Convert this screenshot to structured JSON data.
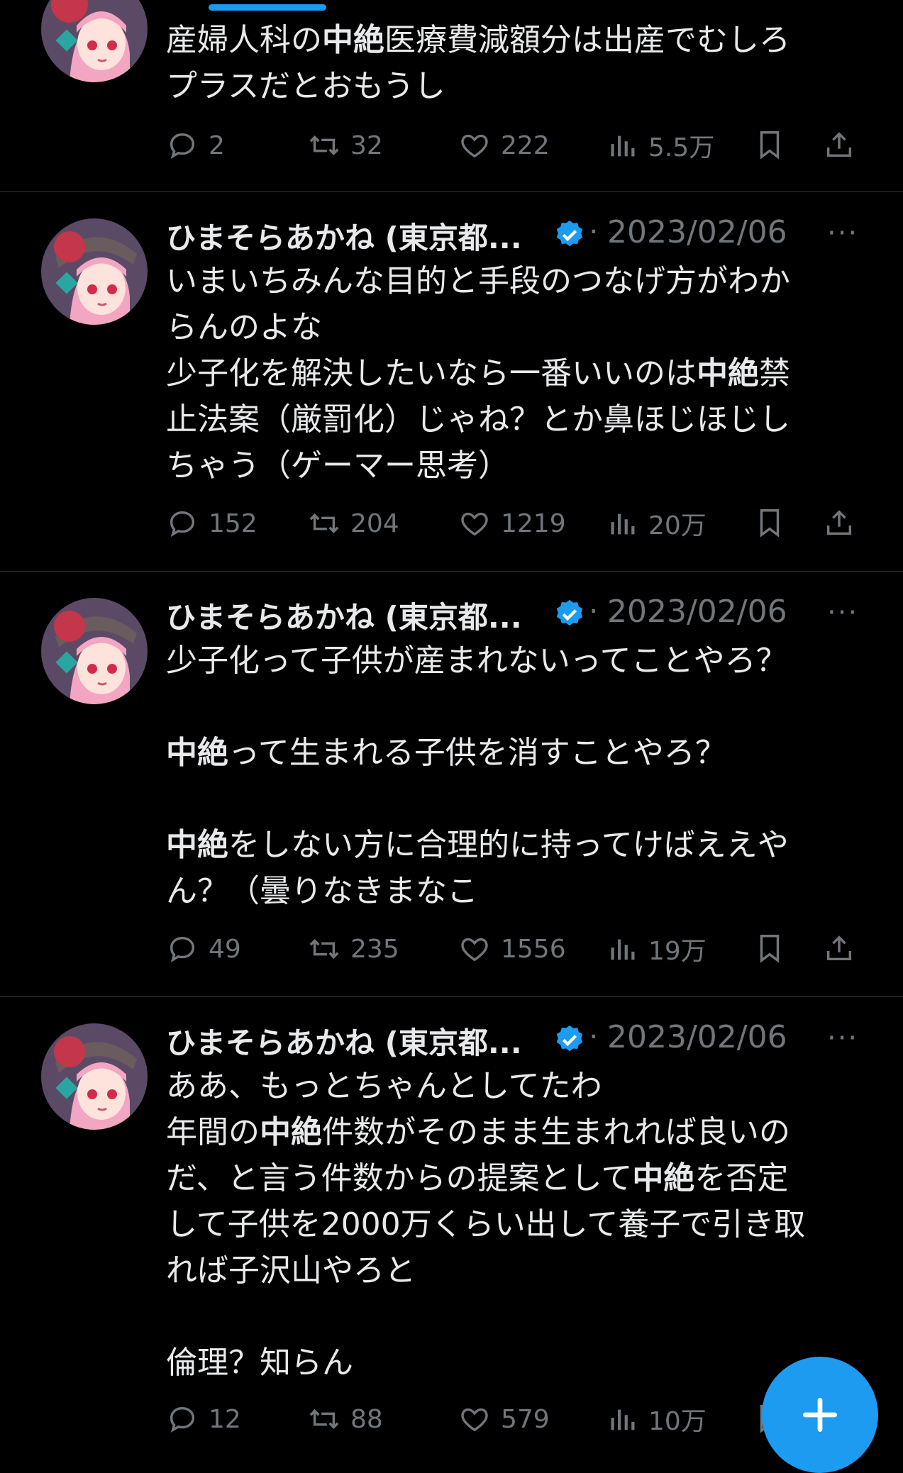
{
  "colors": {
    "accent": "#1d9bf0",
    "muted": "#71767b",
    "text": "#e7e9ea"
  },
  "icons": [
    "reply-icon",
    "retweet-icon",
    "like-icon",
    "views-icon",
    "bookmark-icon",
    "share-icon",
    "verified-icon",
    "more-icon",
    "compose-plus-icon"
  ],
  "tweets": [
    {
      "partial": true,
      "body": [
        {
          "text": "産婦人科の"
        },
        {
          "text": "中絶",
          "bold": true
        },
        {
          "text": "医療費減額分は出産でむしろ\nプラスだとおもうし"
        }
      ],
      "stats": {
        "replies": "2",
        "retweets": "32",
        "likes": "222",
        "views": "5.5万"
      }
    },
    {
      "name": "ひまそらあかね (東京都...",
      "dot": "·",
      "date": "2023/02/06",
      "more": "···",
      "body": [
        {
          "text": "いまいちみんな目的と手段のつなげ方がわか\nらんのよな\n少子化を解決したいなら一番いいのは"
        },
        {
          "text": "中絶",
          "bold": true
        },
        {
          "text": "禁\n止法案（厳罰化）じゃね？とか鼻ほじほじし\nちゃう（ゲーマー思考）"
        }
      ],
      "stats": {
        "replies": "152",
        "retweets": "204",
        "likes": "1219",
        "views": "20万"
      }
    },
    {
      "name": "ひまそらあかね (東京都...",
      "dot": "·",
      "date": "2023/02/06",
      "more": "···",
      "body": [
        {
          "text": "少子化って子供が産まれないってことやろ？\n\n"
        },
        {
          "text": "中絶",
          "bold": true
        },
        {
          "text": "って生まれる子供を消すことやろ？\n\n"
        },
        {
          "text": "中絶",
          "bold": true
        },
        {
          "text": "をしない方に合理的に持ってけばええや\nん？（曇りなきまなこ"
        }
      ],
      "stats": {
        "replies": "49",
        "retweets": "235",
        "likes": "1556",
        "views": "19万"
      }
    },
    {
      "name": "ひまそらあかね (東京都...",
      "dot": "·",
      "date": "2023/02/06",
      "more": "···",
      "body": [
        {
          "text": "ああ、もっとちゃんとしてたわ\n年間の"
        },
        {
          "text": "中絶",
          "bold": true
        },
        {
          "text": "件数がそのまま生まれれば良いの\nだ、と言う件数からの提案として"
        },
        {
          "text": "中絶",
          "bold": true
        },
        {
          "text": "を否定\nして子供を2000万くらい出して養子で引き取\nれば子沢山やろと\n\n倫理？知らん"
        }
      ],
      "stats": {
        "replies": "12",
        "retweets": "88",
        "likes": "579",
        "views": "10万"
      }
    }
  ]
}
